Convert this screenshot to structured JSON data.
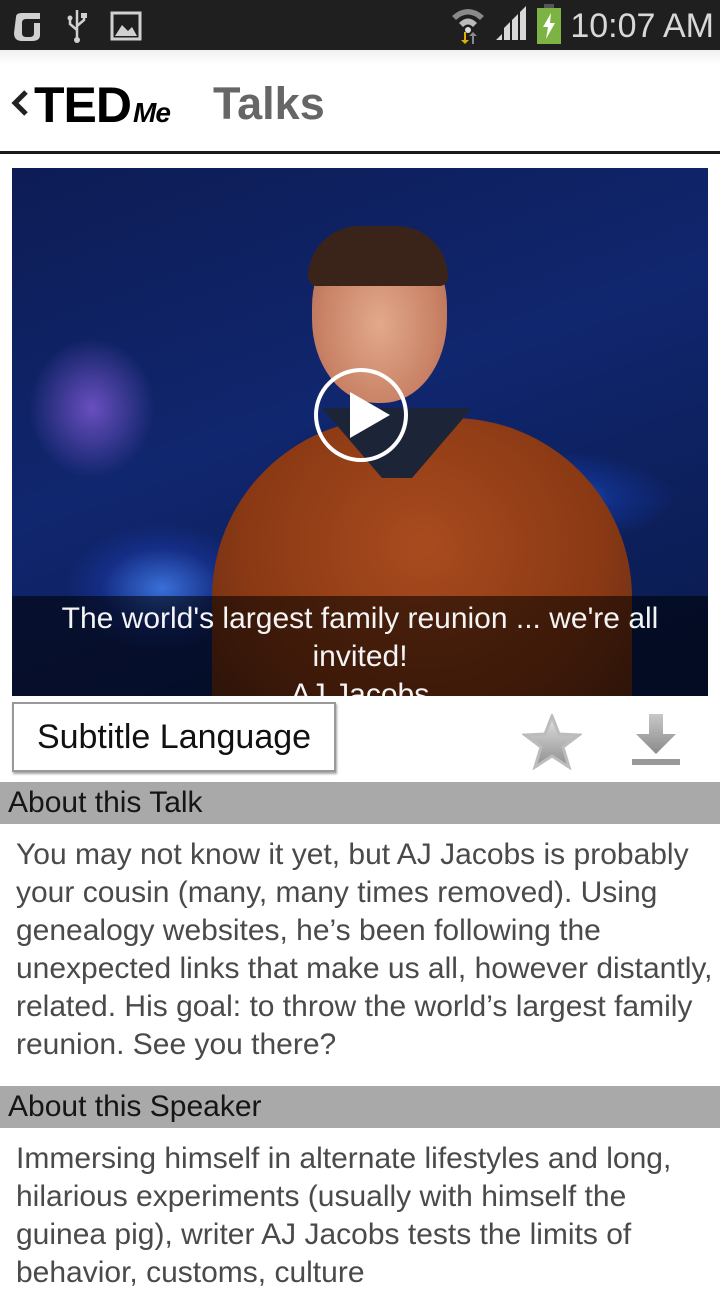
{
  "status_bar": {
    "time": "10:07 AM",
    "left_icons": [
      "app-notification-icon",
      "usb-icon",
      "image-icon"
    ],
    "right_icons": [
      "wifi-icon",
      "signal-icon",
      "battery-charging-icon"
    ],
    "colors": {
      "background": "#1f1f1f",
      "battery": "#7cb342",
      "wifi_down_arrow": "#e0b000"
    }
  },
  "app_bar": {
    "logo_main": "TED",
    "logo_sub": "Me",
    "title": "Talks"
  },
  "video": {
    "talk_title": "The world's largest family reunion ... we're all invited!",
    "speaker": "AJ Jacobs"
  },
  "actions": {
    "subtitle_language_label": "Subtitle Language",
    "favorite_icon": "star-icon",
    "download_icon": "download-icon"
  },
  "about_talk": {
    "heading": "About this Talk",
    "body": "You may not know it yet, but AJ Jacobs is probably your cousin (many, many times removed). Using genealogy websites, he’s been following the unexpected links that make us all, however distantly, related. His goal: to throw the world’s largest family reunion. See you there?"
  },
  "about_speaker": {
    "heading": "About this Speaker",
    "body": "Immersing himself in alternate lifestyles and long, hilarious experiments (usually with himself the guinea pig), writer AJ Jacobs tests the limits of behavior, customs, culture"
  }
}
